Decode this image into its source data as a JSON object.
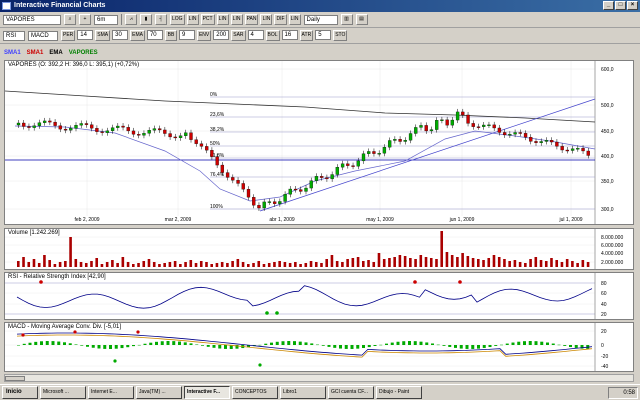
{
  "window": {
    "title": "Interactive Financial Charts"
  },
  "toolbar1": {
    "symbol": "VAPORES",
    "range": "6m",
    "period": "Daily",
    "buttons": [
      "LOG",
      "LIN",
      "PCT",
      "LIN",
      "LIN",
      "PAN",
      "LIN",
      "DIF",
      "LIN"
    ]
  },
  "toolbar2": {
    "indicator1": "RSI",
    "indicator2": "MACD",
    "params": [
      "14",
      "30",
      "70",
      "9",
      "200",
      "4",
      "16",
      "5"
    ],
    "labels": [
      "PER",
      "SMA",
      "EMA",
      "BB",
      "ENV",
      "SAR",
      "BOL",
      "ATR",
      "STO"
    ]
  },
  "legend": {
    "items": [
      {
        "label": "SMA1",
        "color": "#4040ff"
      },
      {
        "label": "SMA1",
        "color": "#cc0000"
      },
      {
        "label": "EMA",
        "color": "#000000"
      },
      {
        "label": "VAPORES",
        "color": "#008000"
      }
    ]
  },
  "price_panel": {
    "header": "VAPORES (O: 392,2  H: 396,0  L: 395,1) (+0,72%)",
    "y_ticks": [
      "600,0",
      "500,0",
      "450,0",
      "400,0",
      "350,0",
      "300,0"
    ],
    "x_ticks": [
      "feb 2, 2009",
      "mar 2, 2009",
      "abr 1, 2009",
      "may 1, 2009",
      "jun 1, 2009",
      "jul 1, 2009"
    ],
    "fib_labels": [
      "0%",
      "23,6%",
      "38,2%",
      "50%",
      "61,8%",
      "76,4%",
      "100%"
    ]
  },
  "volume_panel": {
    "header": "Volume [1.242.269]",
    "y_ticks": [
      "8.000.000",
      "6.000.000",
      "4.000.000",
      "2.000.000"
    ]
  },
  "rsi_panel": {
    "header": "RSI - Relative Strength Index [42,90]",
    "y_ticks": [
      "80",
      "60",
      "40",
      "20"
    ]
  },
  "macd_panel": {
    "header": "MACD - Moving Average Conv. Div. [-5,01]",
    "y_ticks": [
      "20",
      "0",
      "-20",
      "-40"
    ]
  },
  "taskbar": {
    "start": "Inicio",
    "tasks": [
      "Microsoft ...",
      "Internet E...",
      "Java(TM) ...",
      "Interactive F...",
      "CONCEPTOS",
      "Libro1",
      "GCI cuenta CF...",
      "Dibujo - Paint"
    ],
    "active_index": 3,
    "clock": "0:58"
  }
}
